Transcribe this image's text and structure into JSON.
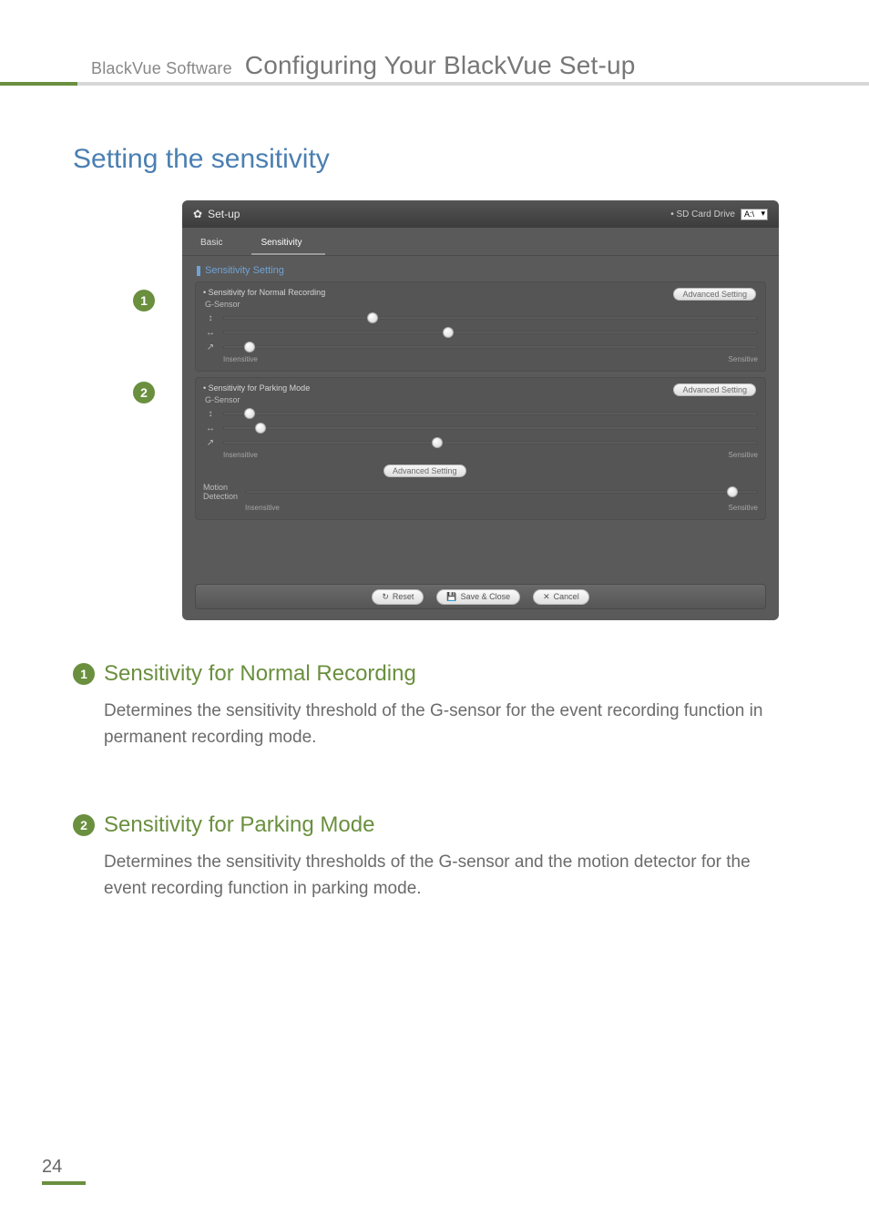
{
  "header": {
    "small": "BlackVue Software",
    "large": "Configuring Your BlackVue Set-up"
  },
  "section_title": "Setting the sensitivity",
  "callouts": {
    "c1": "1",
    "c2": "2"
  },
  "page_number": "24",
  "shot": {
    "window_title": "Set-up",
    "sd_label": "• SD Card Drive",
    "sd_value": "A:\\",
    "tabs": {
      "basic": "Basic",
      "sensitivity": "Sensitivity"
    },
    "panel_title": "Sensitivity Setting",
    "normal": {
      "title": "• Sensitivity for Normal Recording",
      "gsensor": "G-Sensor",
      "adv": "Advanced Setting",
      "slider1": 28,
      "slider2": 42,
      "slider3": 5,
      "left_scale": "Insensitive",
      "right_scale": "Sensitive"
    },
    "parking": {
      "title": "• Sensitivity for Parking Mode",
      "gsensor": "G-Sensor",
      "adv1": "Advanced Setting",
      "adv2": "Advanced Setting",
      "slider1": 5,
      "slider2": 7,
      "slider3": 40,
      "left_scale": "Insensitive",
      "right_scale": "Sensitive",
      "motion_label": "Motion\nDetection",
      "motion_slider": 95,
      "m_left": "Insensitive",
      "m_right": "Sensitive"
    },
    "footer": {
      "reset": "Reset",
      "save": "Save & Close",
      "cancel": "Cancel"
    }
  },
  "desc": {
    "d1": {
      "num": "1",
      "title": "Sensitivity for Normal Recording",
      "body": "Determines the sensitivity threshold of the G-sensor for the event recording function in permanent recording mode."
    },
    "d2": {
      "num": "2",
      "title": "Sensitivity for Parking Mode",
      "body": "Determines the sensitivity thresholds of the G-sensor and the motion detector for the event recording function in parking mode."
    }
  }
}
